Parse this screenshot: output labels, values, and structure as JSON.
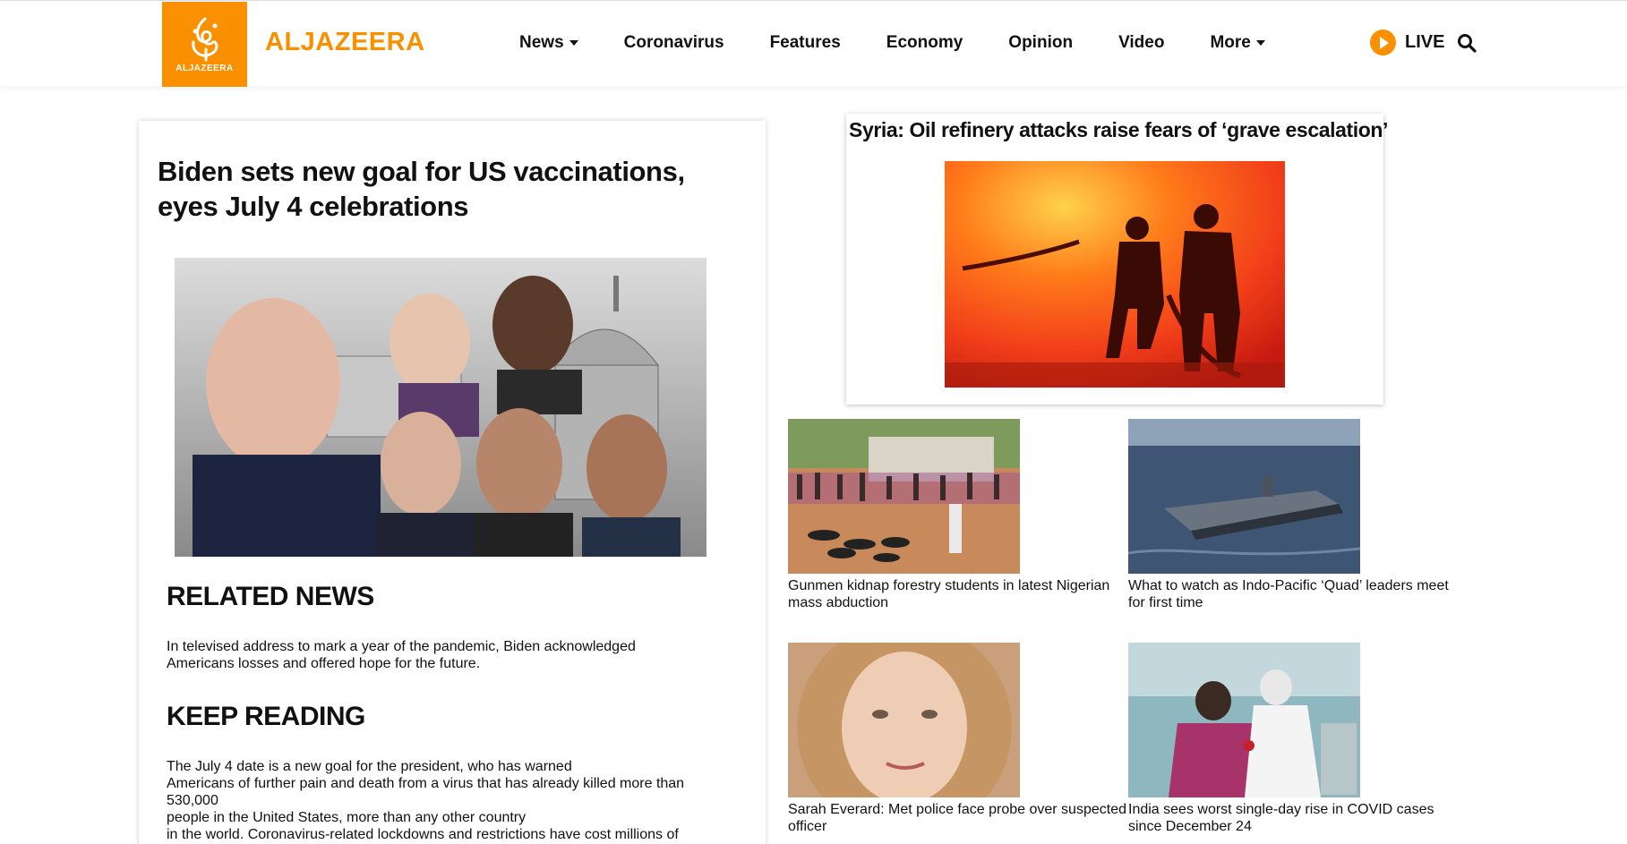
{
  "header": {
    "logo_text": "ALJAZEERA",
    "brand": "ALJAZEERA",
    "brand_color": "#fa9000",
    "nav": [
      {
        "label": "News",
        "dropdown": true
      },
      {
        "label": "Coronavirus",
        "dropdown": false
      },
      {
        "label": "Features",
        "dropdown": false
      },
      {
        "label": "Economy",
        "dropdown": false
      },
      {
        "label": "Opinion",
        "dropdown": false
      },
      {
        "label": "Video",
        "dropdown": false
      },
      {
        "label": "More",
        "dropdown": true
      }
    ],
    "live_label": "LIVE",
    "live_icon": "play-circle-icon",
    "search_icon": "search-icon"
  },
  "main": {
    "title": "Biden sets new goal for US vaccinations, eyes July 4 celebrations",
    "image_desc_icon": "photo-collage",
    "related": {
      "heading": "RELATED NEWS",
      "text": "In televised address to mark a year of the pandemic, Biden acknowledged Americans losses and offered hope for the future."
    },
    "keep": {
      "heading": "KEEP READING",
      "lines": [
        "The July 4 date is a new goal for the president, who has warned",
        "Americans of further pain and death from a virus that has already killed more than",
        "530,000",
        "people in the United States, more than any other country",
        "in the world. Coronavirus-related lockdowns and restrictions have cost millions of"
      ]
    }
  },
  "top_story": {
    "title": "Syria: Oil refinery attacks raise fears of ‘grave escalation’"
  },
  "grid": [
    {
      "caption": "Gunmen kidnap forestry students in latest Nigerian mass abduction"
    },
    {
      "caption": "What to watch as Indo-Pacific ‘Quad’ leaders meet for first time"
    },
    {
      "caption": "Sarah Everard: Met police face probe over suspected officer"
    },
    {
      "caption": "India sees worst single-day rise in COVID cases since December 24"
    }
  ]
}
